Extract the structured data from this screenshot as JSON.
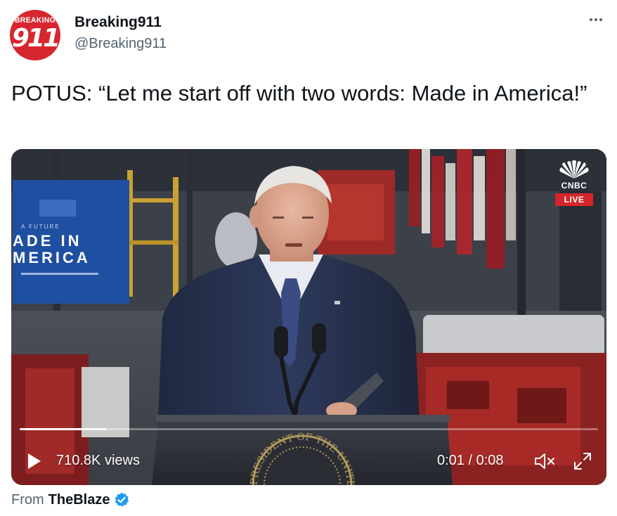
{
  "tweet": {
    "avatar": {
      "top_label": "BREAKING",
      "number": "911"
    },
    "display_name": "Breaking911",
    "handle": "@Breaking911",
    "text": "POTUS: “Let me start off with two words: Made in America!”",
    "more_icon": "more-horizontal-icon"
  },
  "video": {
    "backdrop_sign": {
      "line1": "A FUTURE",
      "line2": "ADE IN",
      "line3": "MERICA"
    },
    "network": {
      "name": "CNBC",
      "badge": "LIVE",
      "icon": "peacock-logo"
    },
    "podium_seal_text": "PRESIDENT OF THE UNITED STATES",
    "views": "710.8K views",
    "time": "0:01 / 0:08",
    "progress": 0.15,
    "icons": {
      "play": "play-icon",
      "mute": "volume-muted-icon",
      "expand": "expand-icon"
    }
  },
  "source": {
    "prefix": "From",
    "name": "TheBlaze",
    "verified_icon": "verified-badge-icon"
  },
  "colors": {
    "brand_red": "#d7262f",
    "text_primary": "#0f1419",
    "text_secondary": "#536471",
    "verified_blue": "#1d9bf0",
    "cnbc_live": "#d6252a"
  }
}
